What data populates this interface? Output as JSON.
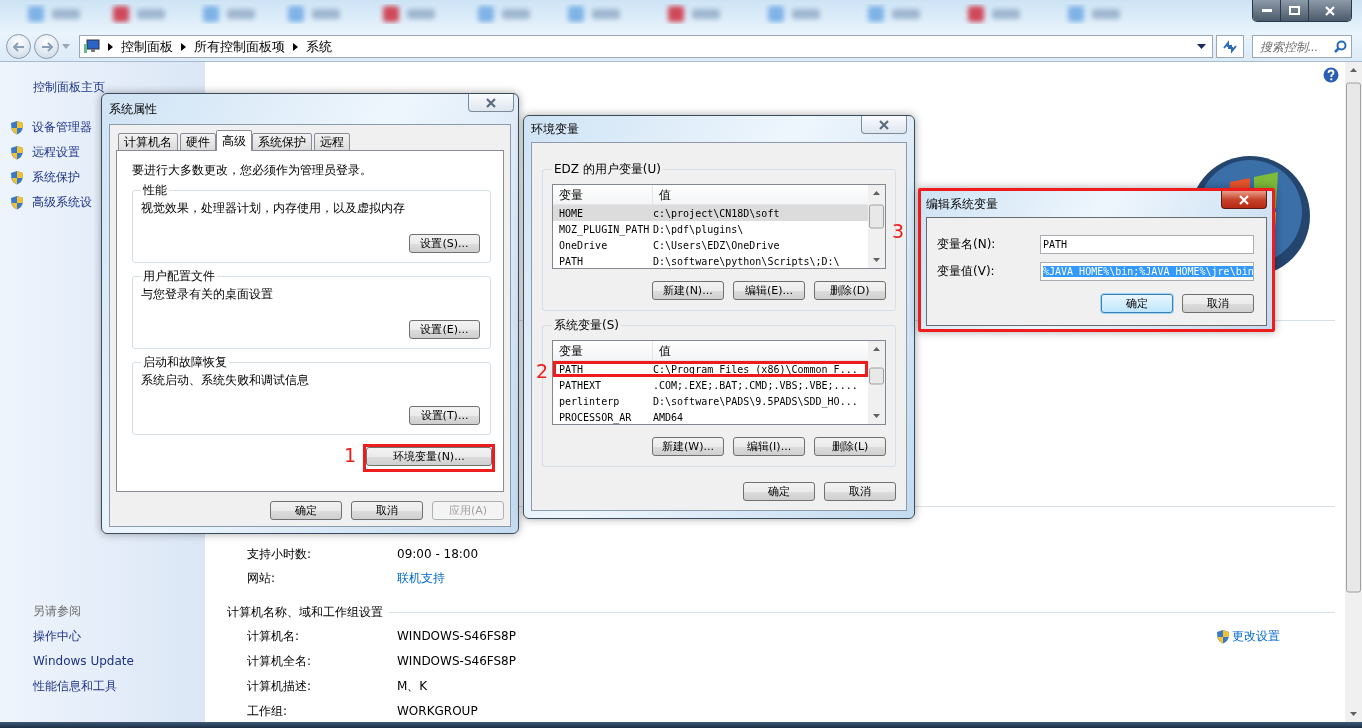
{
  "address_bar": {
    "breadcrumb": [
      "控制面板",
      "所有控制面板项",
      "系统"
    ],
    "search": {
      "placeholder": "搜索控制..."
    }
  },
  "sidebar": {
    "home": "控制面板主页",
    "items": [
      "设备管理器",
      "远程设置",
      "系统保护",
      "高级系统设"
    ],
    "see_also_title": "另请参阅",
    "see_also": [
      "操作中心",
      "Windows Update",
      "性能信息和工具"
    ]
  },
  "support": [
    {
      "label": "支持小时数:",
      "value": "09:00 - 18:00",
      "kind": "text"
    },
    {
      "label": "网站:",
      "value": "联机支持",
      "kind": "link"
    }
  ],
  "computer_section": {
    "title": "计算机名称、域和工作组设置",
    "change_link": "更改设置",
    "rows": [
      {
        "label": "计算机名:",
        "value": "WINDOWS-S46FS8P"
      },
      {
        "label": "计算机全名:",
        "value": "WINDOWS-S46FS8P"
      },
      {
        "label": "计算机描述:",
        "value": "M、K"
      },
      {
        "label": "工作组:",
        "value": "WORKGROUP"
      }
    ]
  },
  "system_properties": {
    "title": "系统属性",
    "tabs": [
      {
        "label": "计算机名",
        "selected": false
      },
      {
        "label": "硬件",
        "selected": false
      },
      {
        "label": "高级",
        "selected": true
      },
      {
        "label": "系统保护",
        "selected": false
      },
      {
        "label": "远程",
        "selected": false
      }
    ],
    "notice": "要进行大多数更改，您必须作为管理员登录。",
    "groups": [
      {
        "title": "性能",
        "description": "视觉效果，处理器计划，内存使用，以及虚拟内存",
        "button": "设置(S)..."
      },
      {
        "title": "用户配置文件",
        "description": "与您登录有关的桌面设置",
        "button": "设置(E)..."
      },
      {
        "title": "启动和故障恢复",
        "description": "系统启动、系统失败和调试信息",
        "button": "设置(T)..."
      }
    ],
    "env_button": {
      "label": "环境变量(N)...",
      "highlighted": true,
      "marker": "1"
    },
    "buttons": [
      {
        "label": "确定",
        "disabled": false
      },
      {
        "label": "取消",
        "disabled": false
      },
      {
        "label": "应用(A)",
        "disabled": true
      }
    ]
  },
  "environment_variables": {
    "title": "环境变量",
    "groups": [
      {
        "title": "EDZ 的用户变量(U)",
        "columns": [
          "变量",
          "值"
        ],
        "rows": [
          {
            "name": "HOME",
            "value": "c:\\project\\CN18D\\soft",
            "selected": true,
            "highlighted": false
          },
          {
            "name": "MOZ_PLUGIN_PATH",
            "value": "D:\\pdf\\plugins\\",
            "selected": false,
            "highlighted": false
          },
          {
            "name": "OneDrive",
            "value": "C:\\Users\\EDZ\\OneDrive",
            "selected": false,
            "highlighted": false
          },
          {
            "name": "PATH",
            "value": "D:\\software\\python\\Scripts\\;D:\\",
            "selected": false,
            "highlighted": false
          }
        ],
        "buttons": [
          "新建(N)...",
          "编辑(E)...",
          "删除(D)"
        ]
      },
      {
        "title": "系统变量(S)",
        "columns": [
          "变量",
          "值"
        ],
        "rows": [
          {
            "name": "PATH",
            "value": "C:\\Program Files (x86)\\Common F...",
            "selected": false,
            "highlighted": true,
            "marker": "2"
          },
          {
            "name": "PATHEXT",
            "value": ".COM;.EXE;.BAT;.CMD;.VBS;.VBE;....",
            "selected": false,
            "highlighted": false
          },
          {
            "name": "perlinterp",
            "value": "D:\\software\\PADS\\9.5PADS\\SDD_HO...",
            "selected": false,
            "highlighted": false
          },
          {
            "name": "PROCESSOR_AR",
            "value": "AMD64",
            "selected": false,
            "highlighted": false
          }
        ],
        "buttons": [
          "新建(W)...",
          "编辑(I)...",
          "删除(L)"
        ]
      }
    ],
    "buttons": [
      "确定",
      "取消"
    ]
  },
  "edit_dialog": {
    "title": "编辑系统变量",
    "highlighted": true,
    "marker": "3",
    "fields": [
      {
        "label": "变量名(N):",
        "value": "PATH",
        "selected": false
      },
      {
        "label": "变量值(V):",
        "value": "%JAVA_HOME%\\bin;%JAVA_HOME%\\jre\\bin",
        "selected": true
      }
    ],
    "buttons": [
      {
        "label": "确定",
        "default": true
      },
      {
        "label": "取消",
        "default": false
      }
    ]
  }
}
